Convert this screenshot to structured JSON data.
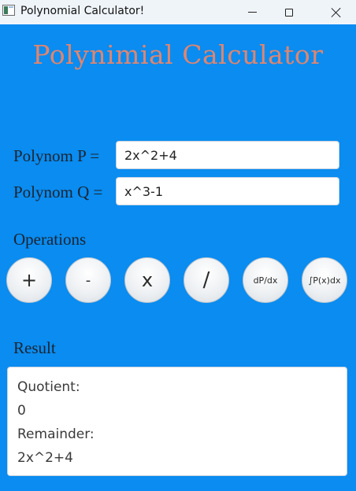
{
  "window": {
    "title": "Polynomial Calculator!"
  },
  "heading": "Polynimial Calculator",
  "inputs": {
    "p_label": "Polynom P =",
    "p_value": "2x^2+4",
    "q_label": "Polynom Q =",
    "q_value": "x^3-1"
  },
  "operations": {
    "label": "Operations",
    "buttons": [
      "+",
      "-",
      "x",
      "/",
      "dP/dx",
      "∫P(x)dx"
    ]
  },
  "result": {
    "label": "Result",
    "lines": [
      "Quotient:",
      "0",
      "Remainder:",
      "2x^2+4"
    ]
  },
  "colors": {
    "background": "#0a8cf0",
    "heading": "#e0856e"
  }
}
